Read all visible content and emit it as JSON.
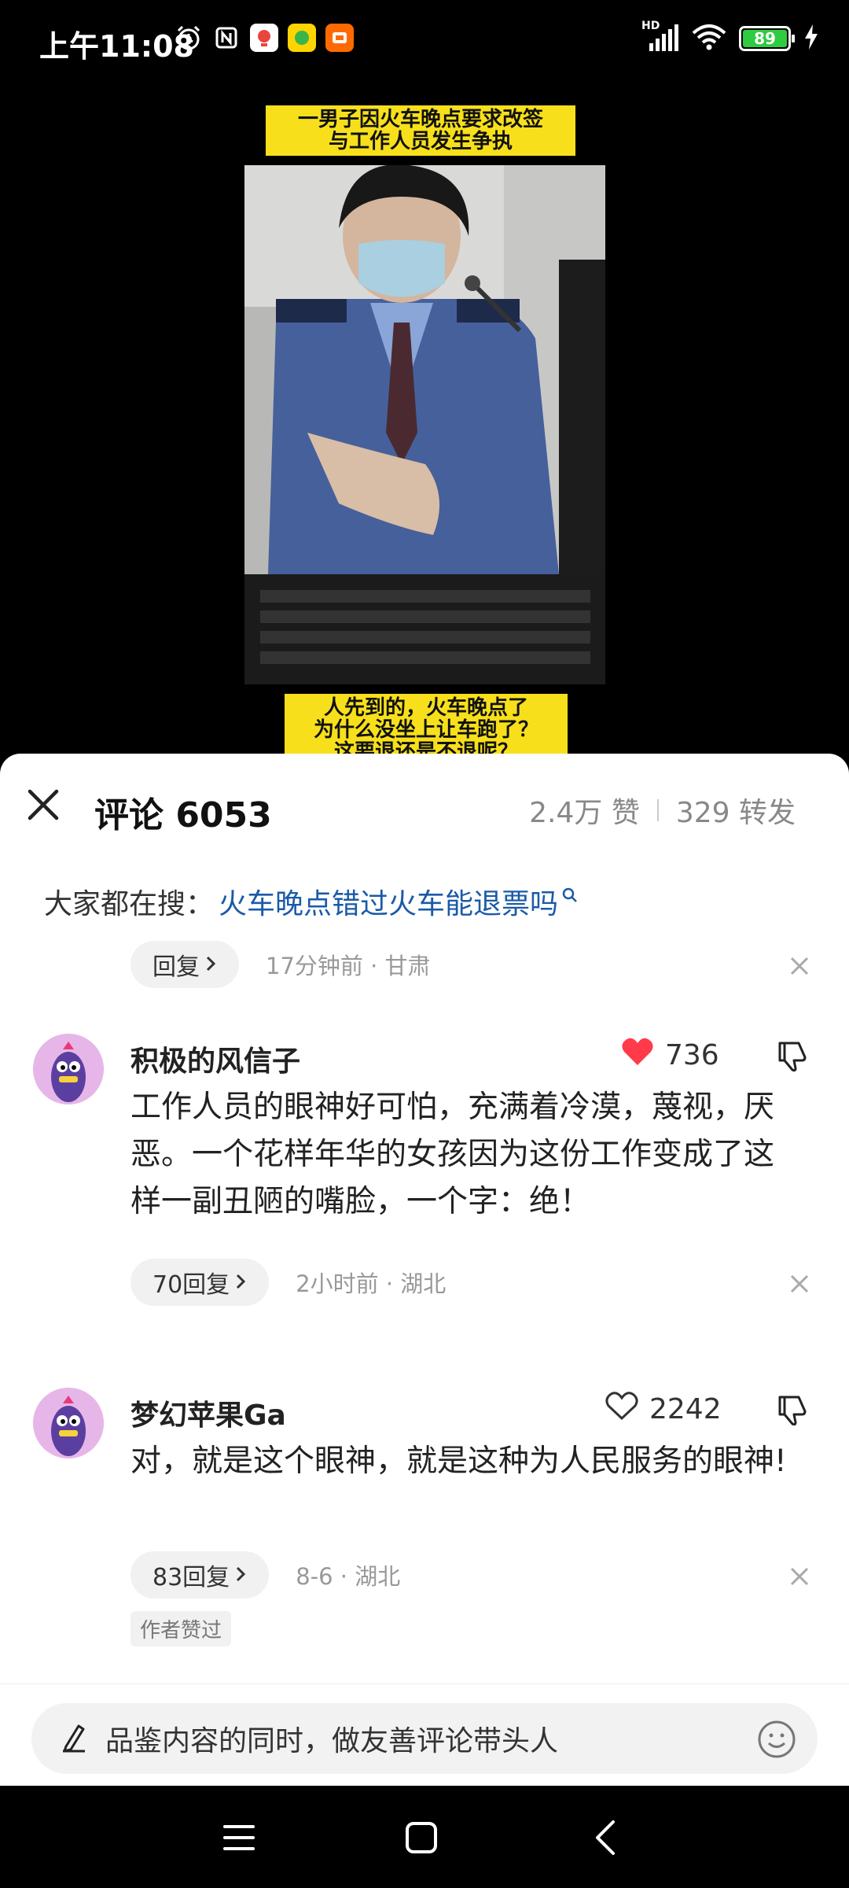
{
  "status_bar": {
    "time": "上午11:08",
    "network": "HD",
    "battery": "89"
  },
  "video": {
    "caption_top_line1": "一男子因火车晚点要求改签",
    "caption_top_line2": "与工作人员发生争执",
    "caption_bottom_line1": "人先到的，火车晚点了",
    "caption_bottom_line2": "为什么没坐上让车跑了？",
    "caption_bottom_line3": "这要退还是不退呢？"
  },
  "sheet": {
    "title": "评论 6053",
    "likes": "2.4万 赞",
    "shares": "329 转发",
    "search_label": "大家都在搜：",
    "search_link": "火车晚点错过火车能退票吗"
  },
  "prev_reply": {
    "reply_label": "回复",
    "meta": "17分钟前 · 甘肃"
  },
  "comments": [
    {
      "username": "积极的风信子",
      "like_count": "736",
      "text": "工作人员的眼神好可怕，充满着冷漠，蔑视，厌恶。一个花样年华的女孩因为这份工作变成了这样一副丑陋的嘴脸，一个字：绝！",
      "reply_label": "70回复",
      "meta": "2小时前 · 湖北"
    },
    {
      "username": "梦幻苹果Ga",
      "like_count": "2242",
      "text": "对，就是这个眼神，就是这种为人民服务的眼神!",
      "reply_label": "83回复",
      "meta": "8-6 · 湖北",
      "badge": "作者赞过"
    }
  ],
  "input": {
    "placeholder": "品鉴内容的同时，做友善评论带头人"
  },
  "colors": {
    "accent_link": "#1a5aa8",
    "like_red": "#ff3b4a",
    "caption_yellow": "#f7e01b"
  },
  "icons": [
    "alarm-icon",
    "nfc-icon",
    "signal-icon",
    "wifi-icon",
    "battery-icon",
    "charging-icon",
    "close-icon",
    "search-icon",
    "chevron-right-icon",
    "dismiss-icon",
    "heart-icon",
    "thumbs-down-icon",
    "pen-icon",
    "emoji-icon",
    "menu-icon",
    "home-icon",
    "back-icon"
  ]
}
